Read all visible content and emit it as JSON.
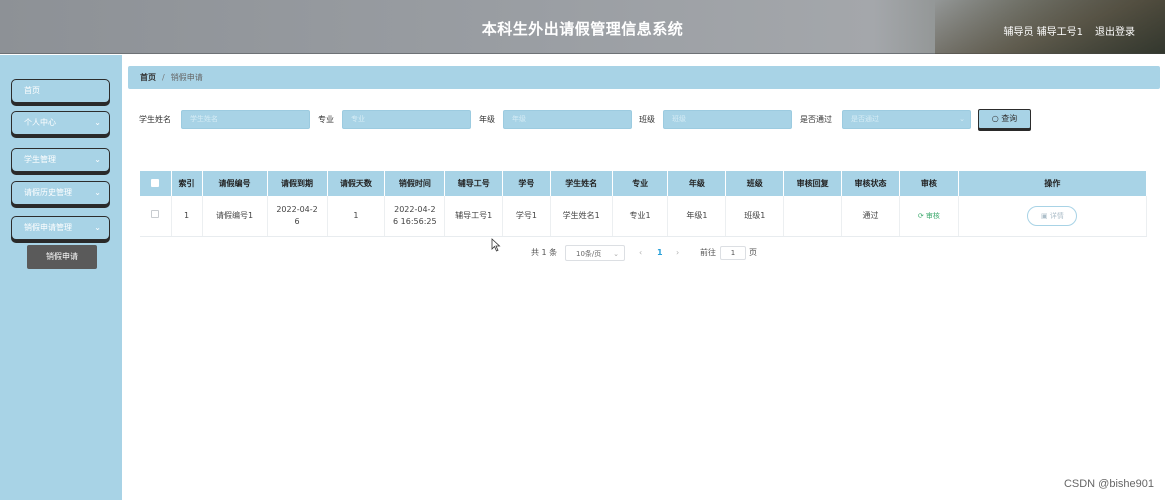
{
  "header": {
    "title": "本科生外出请假管理信息系统",
    "user": "辅导员 辅导工号1",
    "logout": "退出登录"
  },
  "sidebar": {
    "items": [
      {
        "label": "首页"
      },
      {
        "label": "个人中心"
      },
      {
        "label": "学生管理"
      },
      {
        "label": "请假历史管理"
      },
      {
        "label": "销假申请管理"
      }
    ],
    "active_sub": "销假申请"
  },
  "breadcrumb": {
    "home": "首页",
    "current": "销假申请"
  },
  "search": {
    "fields": [
      {
        "label": "学生姓名",
        "placeholder": "学生姓名"
      },
      {
        "label": "专业",
        "placeholder": "专业"
      },
      {
        "label": "年级",
        "placeholder": "年级"
      },
      {
        "label": "班级",
        "placeholder": "班级"
      },
      {
        "label": "是否通过",
        "placeholder": "是否通过"
      }
    ],
    "query_button": "查询"
  },
  "table": {
    "headers": [
      "索引",
      "请假编号",
      "请假到期",
      "请假天数",
      "销假时间",
      "辅导工号",
      "学号",
      "学生姓名",
      "专业",
      "年级",
      "班级",
      "审核回复",
      "审核状态",
      "审核",
      "操作"
    ],
    "rows": [
      {
        "index": "1",
        "leave_no": "请假编号1",
        "due_a": "2022-04-2",
        "due_b": "6",
        "days": "1",
        "time_a": "2022-04-2",
        "time_b": "6 16:56:25",
        "counselor": "辅导工号1",
        "student_no": "学号1",
        "name": "学生姓名1",
        "major": "专业1",
        "grade": "年级1",
        "class": "班级1",
        "reply": "",
        "status": "通过",
        "review": "审核",
        "detail": "详情"
      }
    ]
  },
  "pagination": {
    "total": "共 1 条",
    "page_size": "10条/页",
    "current": "1",
    "goto": "前往",
    "goto_value": "1",
    "page_unit": "页"
  },
  "watermark": "CSDN @bishe901",
  "colors": {
    "accent": "#a8d3e6",
    "active_sub": "#5a5a5a",
    "review": "#3aa86b"
  }
}
